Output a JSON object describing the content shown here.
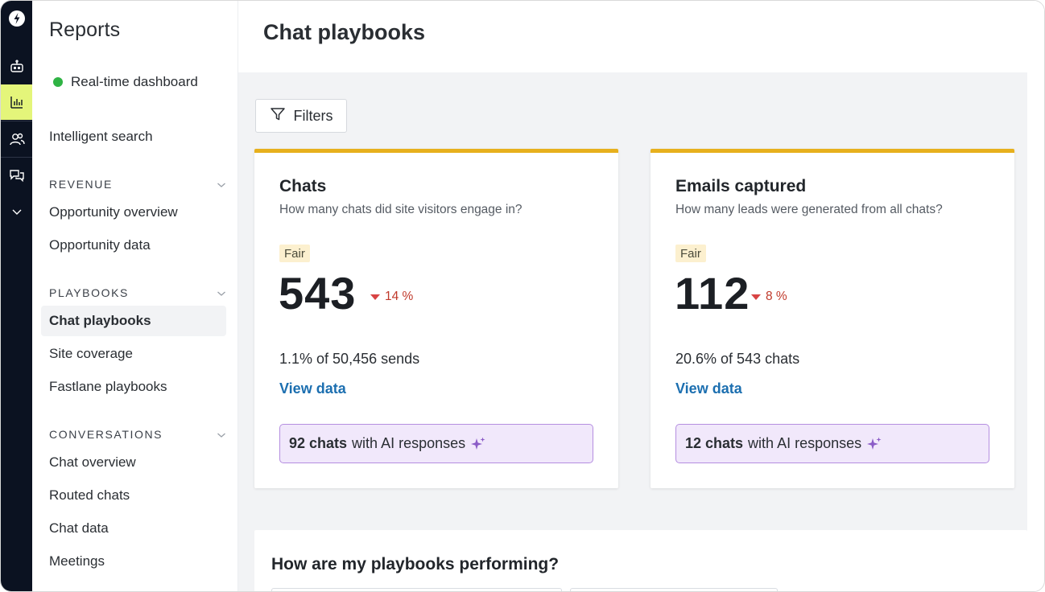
{
  "rail": {
    "icons": [
      "logo-icon",
      "robot-icon",
      "bar-chart-icon",
      "people-icon",
      "chat-bubbles-icon",
      "chevron-down-icon"
    ],
    "active_index": 2,
    "accent_color": "#e4f57a"
  },
  "sidebar": {
    "title": "Reports",
    "realtime_label": "Real-time dashboard",
    "intelligent_search": "Intelligent search",
    "sections": {
      "revenue": {
        "label": "REVENUE",
        "items": [
          "Opportunity overview",
          "Opportunity data"
        ]
      },
      "playbooks": {
        "label": "PLAYBOOKS",
        "items": [
          "Chat playbooks",
          "Site coverage",
          "Fastlane playbooks"
        ],
        "active": "Chat playbooks"
      },
      "conversations": {
        "label": "CONVERSATIONS",
        "items": [
          "Chat overview",
          "Routed chats",
          "Chat data",
          "Meetings"
        ]
      }
    }
  },
  "main": {
    "page_title": "Chat playbooks",
    "filters_label": "Filters",
    "cards": [
      {
        "title": "Chats",
        "subtitle": "How many chats did site visitors engage in?",
        "rating": "Fair",
        "value": "543",
        "delta": "14 %",
        "ratio": "1.1% of 50,456 sends",
        "link": "View data",
        "ai_count": "92 chats",
        "ai_text": "with AI responses"
      },
      {
        "title": "Emails captured",
        "subtitle": "How many leads were generated from all chats?",
        "rating": "Fair",
        "value": "112",
        "delta": "8 %",
        "ratio": "20.6% of 543 chats",
        "link": "View data",
        "ai_count": "12 chats",
        "ai_text": "with AI responses"
      }
    ],
    "performance_title": "How are my playbooks performing?"
  },
  "colors": {
    "card_accent": "#e7b01d",
    "link": "#1c6fb0",
    "decline": "#d84444",
    "ai_box_bg": "#f1e8fb",
    "ai_box_border": "#b58ee0",
    "live_dot": "#2fb344"
  }
}
